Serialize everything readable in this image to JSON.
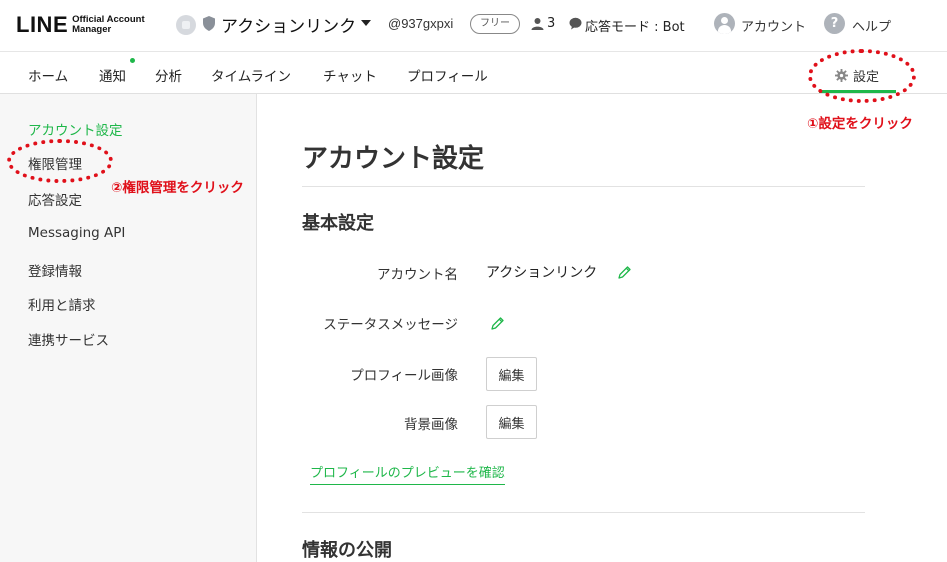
{
  "header": {
    "logo_main": "LINE",
    "logo_sub_line1": "Official Account",
    "logo_sub_line2": "Manager",
    "account_name": "アクションリンク",
    "account_id": "@937gxpxi",
    "plan_badge": "フリー",
    "friends_count": "3",
    "mode": "応答モード : Bot",
    "account_link": "アカウント",
    "help_link": "ヘルプ"
  },
  "nav": {
    "items": [
      "ホーム",
      "通知",
      "分析",
      "タイムライン",
      "チャット",
      "プロフィール"
    ],
    "settings": "設定"
  },
  "sidebar": {
    "items": [
      {
        "label": "アカウント設定",
        "active": true
      },
      {
        "label": "権限管理",
        "active": false
      },
      {
        "label": "応答設定",
        "active": false
      },
      {
        "label": "Messaging API",
        "active": false
      },
      {
        "label": "登録情報",
        "active": false
      },
      {
        "label": "利用と請求",
        "active": false
      },
      {
        "label": "連携サービス",
        "active": false
      }
    ]
  },
  "main": {
    "page_title": "アカウント設定",
    "basic_section_title": "基本設定",
    "fields": {
      "account_name_label": "アカウント名",
      "account_name_value": "アクションリンク",
      "status_label": "ステータスメッセージ",
      "profile_image_label": "プロフィール画像",
      "background_image_label": "背景画像"
    },
    "edit_label": "編集",
    "preview_link": "プロフィールのプレビューを確認",
    "public_section_title": "情報の公開"
  },
  "annotations": {
    "step1": "①設定をクリック",
    "step2": "②権限管理をクリック"
  },
  "colors": {
    "accent_green": "#1fb74a",
    "annotation_red": "#e0101a"
  }
}
